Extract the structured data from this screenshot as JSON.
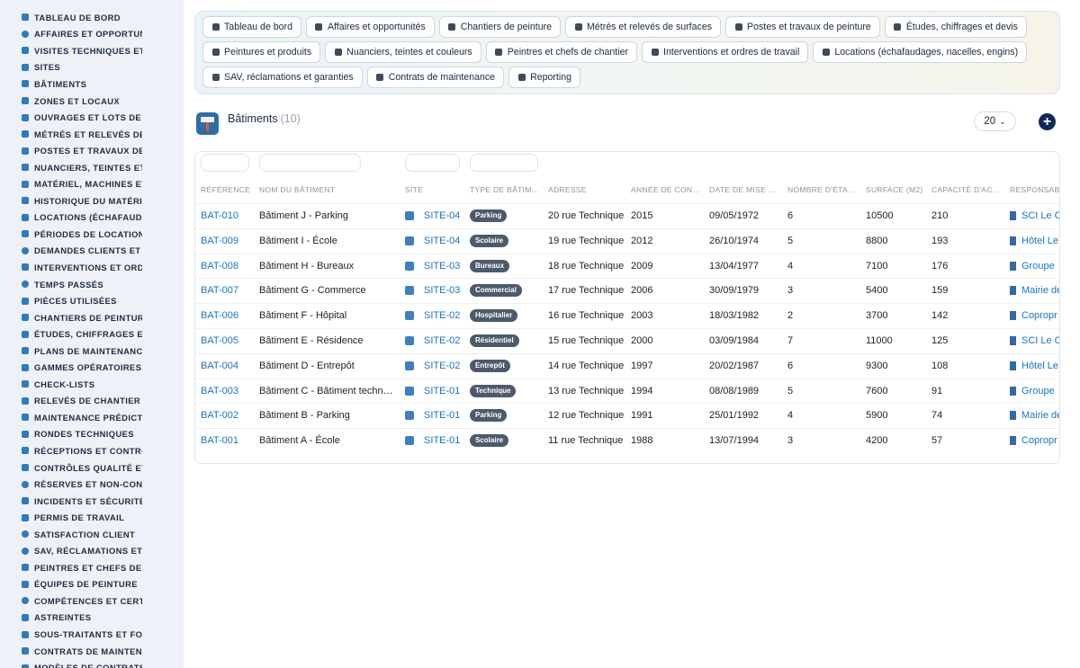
{
  "sidebar": {
    "items": [
      {
        "label": "TABLEAU DE BORD",
        "icon": "dashboard-icon"
      },
      {
        "label": "AFFAIRES ET OPPORTUN",
        "icon": "target-icon"
      },
      {
        "label": "VISITES TECHNIQUES ET",
        "icon": "clipboard-icon"
      },
      {
        "label": "SITES",
        "icon": "map-pin-icon"
      },
      {
        "label": "BÂTIMENTS",
        "icon": "building-icon"
      },
      {
        "label": "ZONES ET LOCAUX",
        "icon": "grid-icon"
      },
      {
        "label": "OUVRAGES ET LOTS DE T",
        "icon": "sitemap-icon"
      },
      {
        "label": "MÉTRÉS ET RELEVÉS DE",
        "icon": "ruler-icon"
      },
      {
        "label": "POSTES ET TRAVAUX DE",
        "icon": "paint-roller-icon"
      },
      {
        "label": "NUANCIERS, TEINTES ET",
        "icon": "palette-icon"
      },
      {
        "label": "MATÉRIEL, MACHINES ET",
        "icon": "cogs-icon"
      },
      {
        "label": "HISTORIQUE DU MATÉRIE",
        "icon": "history-icon"
      },
      {
        "label": "LOCATIONS (ÉCHAFAUDA",
        "icon": "truck-icon"
      },
      {
        "label": "PÉRIODES DE LOCATION",
        "icon": "calendar-icon"
      },
      {
        "label": "DEMANDES CLIENTS ET I",
        "icon": "question-icon"
      },
      {
        "label": "INTERVENTIONS ET ORDI",
        "icon": "clipboard-check-icon"
      },
      {
        "label": "TEMPS PASSÉS",
        "icon": "clock-icon"
      },
      {
        "label": "PIÈCES UTILISÉES",
        "icon": "puzzle-icon"
      },
      {
        "label": "CHANTIERS DE PEINTURI",
        "icon": "hammer-icon"
      },
      {
        "label": "ÉTUDES, CHIFFRAGES ET",
        "icon": "people-icon"
      },
      {
        "label": "PLANS DE MAINTENANCE",
        "icon": "calendar-check-icon"
      },
      {
        "label": "GAMMES OPÉRATOIRES",
        "icon": "list-ordered-icon"
      },
      {
        "label": "CHECK-LISTS",
        "icon": "checklist-icon"
      },
      {
        "label": "RELEVÉS DE CHANTIER",
        "icon": "thermometer-icon"
      },
      {
        "label": "MAINTENANCE PRÉDICTI",
        "icon": "chart-line-icon"
      },
      {
        "label": "RONDES TECHNIQUES",
        "icon": "route-icon"
      },
      {
        "label": "RÉCEPTIONS ET CONTRÔ",
        "icon": "search-icon"
      },
      {
        "label": "CONTRÔLES QUALITÉ ET",
        "icon": "check-square-icon"
      },
      {
        "label": "RÉSERVES ET NON-CONF",
        "icon": "alert-circle-icon"
      },
      {
        "label": "INCIDENTS ET SÉCURITÉ",
        "icon": "warning-triangle-icon"
      },
      {
        "label": "PERMIS DE TRAVAIL",
        "icon": "file-signature-icon"
      },
      {
        "label": "SATISFACTION CLIENT",
        "icon": "smile-icon"
      },
      {
        "label": "SAV, RÉCLAMATIONS ET (",
        "icon": "comment-icon"
      },
      {
        "label": "PEINTRES ET CHEFS DE (",
        "icon": "hard-hat-icon"
      },
      {
        "label": "ÉQUIPES DE PEINTURE",
        "icon": "users-icon"
      },
      {
        "label": "COMPÉTENCES ET CERTI",
        "icon": "certificate-icon"
      },
      {
        "label": "ASTREINTES",
        "icon": "phone-icon"
      },
      {
        "label": "SOUS-TRAITANTS ET FOU",
        "icon": "handshake-icon"
      },
      {
        "label": "CONTRATS DE MAINTENA",
        "icon": "file-contract-icon"
      },
      {
        "label": "MODÈLES DE CONTRATS",
        "icon": "file-icon"
      }
    ]
  },
  "topnav": {
    "rows": [
      [
        {
          "label": "Tableau de bord",
          "icon": "dashboard-icon"
        },
        {
          "label": "Affaires et opportunités",
          "icon": "target-icon"
        },
        {
          "label": "Chantiers de peinture",
          "icon": "hammer-icon"
        },
        {
          "label": "Métrés et relevés de surfaces",
          "icon": "ruler-icon"
        },
        {
          "label": "Postes et travaux de peinture",
          "icon": "paint-roller-icon"
        },
        {
          "label": "Études, chiffrages et devis",
          "icon": "people-icon"
        }
      ],
      [
        {
          "label": "Peintures et produits",
          "icon": "fill-drip-icon"
        },
        {
          "label": "Nuanciers, teintes et couleurs",
          "icon": "palette-icon"
        },
        {
          "label": "Peintres et chefs de chantier",
          "icon": "hard-hat-icon"
        },
        {
          "label": "Interventions et ordres de travail",
          "icon": "clipboard-check-icon"
        },
        {
          "label": "Locations (échafaudages, nacelles, engins)",
          "icon": "truck-icon"
        }
      ],
      [
        {
          "label": "SAV, réclamations et garanties",
          "icon": "comment-icon"
        },
        {
          "label": "Contrats de maintenance",
          "icon": "file-contract-icon"
        },
        {
          "label": "Reporting",
          "icon": "chart-pie-icon"
        }
      ]
    ]
  },
  "header": {
    "title": "Bâtiments",
    "count": "(10)",
    "page_size": "20",
    "module_icon": "paint-roller-icon"
  },
  "table": {
    "columns": [
      "RÉFÉRENCE",
      "NOM DU BÂTIMENT",
      "SITE",
      "TYPE DE BÂTIM...",
      "ADRESSE",
      "ANNÉE DE CON...",
      "DATE DE MISE ...",
      "NOMBRE D'ÉTA...",
      "SURFACE (M2)",
      "CAPACITÉ D'AC...",
      "RESPONSAB"
    ],
    "rows": [
      {
        "ref": "BAT-010",
        "name": "Bâtiment J - Parking",
        "site": "SITE-04",
        "type": "Parking",
        "address": "20 rue Technique",
        "year": "2015",
        "date": "09/05/1972",
        "floors": "6",
        "surface": "10500",
        "capacity": "210",
        "resp": "SCI Le C"
      },
      {
        "ref": "BAT-009",
        "name": "Bâtiment I - École",
        "site": "SITE-04",
        "type": "Scolaire",
        "address": "19 rue Technique",
        "year": "2012",
        "date": "26/10/1974",
        "floors": "5",
        "surface": "8800",
        "capacity": "193",
        "resp": "Hôtel Le"
      },
      {
        "ref": "BAT-008",
        "name": "Bâtiment H - Bureaux",
        "site": "SITE-03",
        "type": "Bureaux",
        "address": "18 rue Technique",
        "year": "2009",
        "date": "13/04/1977",
        "floors": "4",
        "surface": "7100",
        "capacity": "176",
        "resp": "Groupe"
      },
      {
        "ref": "BAT-007",
        "name": "Bâtiment G - Commerce",
        "site": "SITE-03",
        "type": "Commercial",
        "address": "17 rue Technique",
        "year": "2006",
        "date": "30/09/1979",
        "floors": "3",
        "surface": "5400",
        "capacity": "159",
        "resp": "Mairie de"
      },
      {
        "ref": "BAT-006",
        "name": "Bâtiment F - Hôpital",
        "site": "SITE-02",
        "type": "Hospitalier",
        "address": "16 rue Technique",
        "year": "2003",
        "date": "18/03/1982",
        "floors": "2",
        "surface": "3700",
        "capacity": "142",
        "resp": "Copropr"
      },
      {
        "ref": "BAT-005",
        "name": "Bâtiment E - Résidence",
        "site": "SITE-02",
        "type": "Résidentiel",
        "address": "15 rue Technique",
        "year": "2000",
        "date": "03/09/1984",
        "floors": "7",
        "surface": "11000",
        "capacity": "125",
        "resp": "SCI Le C"
      },
      {
        "ref": "BAT-004",
        "name": "Bâtiment D - Entrepôt",
        "site": "SITE-02",
        "type": "Entrepôt",
        "address": "14 rue Technique",
        "year": "1997",
        "date": "20/02/1987",
        "floors": "6",
        "surface": "9300",
        "capacity": "108",
        "resp": "Hôtel Le"
      },
      {
        "ref": "BAT-003",
        "name": "Bâtiment C - Bâtiment techniq...",
        "site": "SITE-01",
        "type": "Technique",
        "address": "13 rue Technique",
        "year": "1994",
        "date": "08/08/1989",
        "floors": "5",
        "surface": "7600",
        "capacity": "91",
        "resp": "Groupe"
      },
      {
        "ref": "BAT-002",
        "name": "Bâtiment B - Parking",
        "site": "SITE-01",
        "type": "Parking",
        "address": "12 rue Technique",
        "year": "1991",
        "date": "25/01/1992",
        "floors": "4",
        "surface": "5900",
        "capacity": "74",
        "resp": "Mairie de"
      },
      {
        "ref": "BAT-001",
        "name": "Bâtiment A - École",
        "site": "SITE-01",
        "type": "Scolaire",
        "address": "11 rue Technique",
        "year": "1988",
        "date": "13/07/1994",
        "floors": "3",
        "surface": "4200",
        "capacity": "57",
        "resp": "Copropr"
      }
    ]
  },
  "colors": {
    "accent": "#1a73c2",
    "sidebar_bg": "#eef1f7",
    "badge_bg": "#4d5a6b",
    "add_button": "#0f2a5a"
  }
}
